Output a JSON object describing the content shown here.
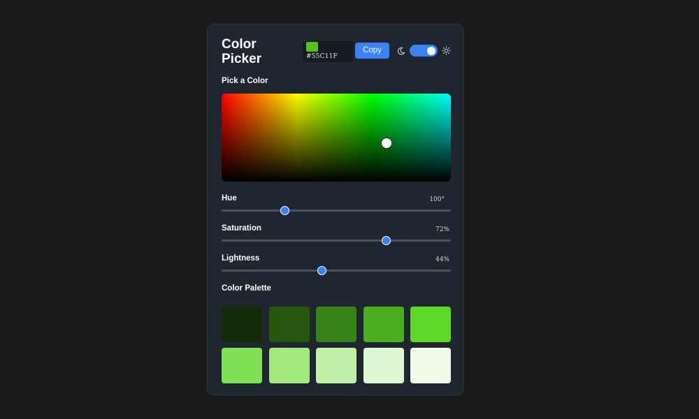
{
  "header": {
    "title": "Color Picker",
    "hex_value": "#55C11F",
    "current_color": "#55C11F",
    "copy_label": "Copy",
    "theme_toggle_on": true
  },
  "picker": {
    "label": "Pick a Color",
    "handle_saturation": 0.72,
    "handle_value": 0.44
  },
  "sliders": [
    {
      "key": "hue",
      "label": "Hue",
      "display": "100°",
      "value": 100,
      "max": 360
    },
    {
      "key": "saturation",
      "label": "Saturation",
      "display": "72%",
      "value": 72,
      "max": 100
    },
    {
      "key": "lightness",
      "label": "Lightness",
      "display": "44%",
      "value": 44,
      "max": 100
    }
  ],
  "palette": {
    "label": "Color Palette",
    "swatches": [
      "#122b08",
      "#26570f",
      "#378317",
      "#4aae1e",
      "#5ed927",
      "#7ee252",
      "#a3ea7e",
      "#c1f1a8",
      "#dff8d3",
      "#eefbe8"
    ]
  },
  "colors": {
    "accent": "#3b82f6",
    "card_bg": "#1f2630",
    "page_bg": "#1b1b1b"
  }
}
